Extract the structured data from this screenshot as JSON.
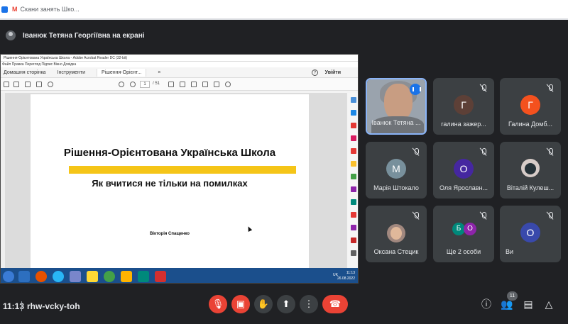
{
  "browser": {
    "tab_title": "Скани занять Шко...",
    "gmail_icon": "gmail-icon"
  },
  "presenter": {
    "label": "Іванюк Тетяна Георгіївна на екрані"
  },
  "shared_screen": {
    "window_title": "Рішення-Орієнтована Українська Школа - Adobe Acrobat Reader DC (32-bit)",
    "menu": "Файл   Правка   Перегляд   Підпис   Вікно   Довідка",
    "tabs": [
      "Домашня сторінка",
      "Інструменти",
      "Рішення-Орієнт..."
    ],
    "sign_in": "Увійти",
    "page_current": "1",
    "page_total": "/ 51",
    "slide": {
      "title": "Рішення-Орієнтована Українська Школа",
      "subtitle": "Як вчитися не тільки на помилках",
      "author": "Вікторія Спащенко"
    },
    "taskbar": {
      "tray_lang": "UK",
      "time": "11:13",
      "date": "26.08.2022"
    }
  },
  "participants": [
    {
      "name": "Іванюк Тетяна ...",
      "type": "video",
      "speaking": true
    },
    {
      "name": "галина зажер...",
      "initial": "Г",
      "color": "#5d4037",
      "muted": true
    },
    {
      "name": "Галина Домб...",
      "initial": "Г",
      "color": "#f4511e",
      "muted": true
    },
    {
      "name": "Марія Штокало",
      "initial": "М",
      "color": "#78909c",
      "muted": true
    },
    {
      "name": "Оля Ярославн...",
      "initial": "О",
      "color": "#4527a0",
      "muted": true
    },
    {
      "name": "Віталій Кулеш...",
      "type": "photo",
      "muted": true
    },
    {
      "name": "Оксана Стецик",
      "type": "photo",
      "muted": true
    },
    {
      "name": "Ще 2 особи",
      "initials": [
        "Б",
        "О"
      ],
      "muted": true
    },
    {
      "name": "Ви",
      "initial": "О",
      "color": "#3949ab",
      "muted": true
    }
  ],
  "bottom_bar": {
    "time": "11:13",
    "meeting_code": "rhw-vcky-toh",
    "participants_count": "11",
    "controls": [
      "mic-off-icon",
      "camera-off-icon",
      "raise-hand-icon",
      "present-icon",
      "more-icon",
      "end-call-icon"
    ],
    "right_controls": [
      "info-icon",
      "people-icon",
      "chat-icon",
      "activities-icon"
    ]
  },
  "colors": {
    "background": "#202124",
    "tile": "#3c4043",
    "danger": "#ea4335",
    "speaking_border": "#8ab4f8",
    "slide_accent": "#f5c518"
  }
}
